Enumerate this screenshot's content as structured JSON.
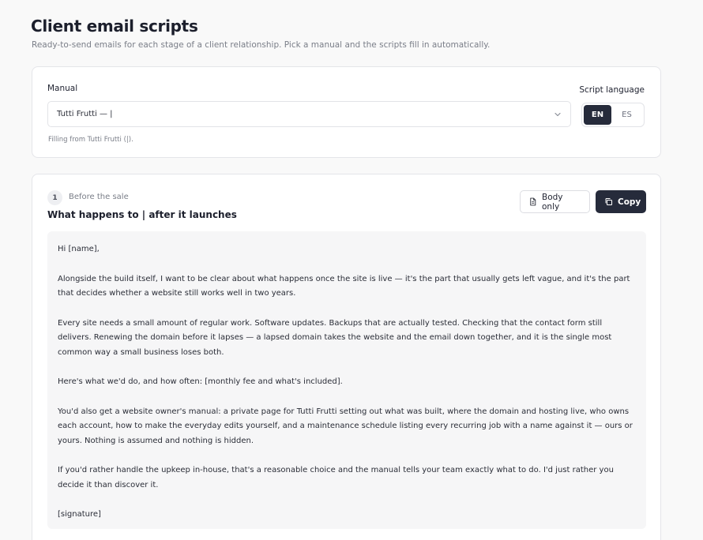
{
  "header": {
    "title": "Client email scripts",
    "subtitle": "Ready-to-send emails for each stage of a client relationship. Pick a manual and the scripts fill in automatically."
  },
  "manual_card": {
    "manual_label": "Manual",
    "selected_manual": "Tutti Frutti — |",
    "filling_hint": "Filling from Tutti Frutti (|).",
    "language_label": "Script language",
    "languages": [
      {
        "code": "EN",
        "active": true
      },
      {
        "code": "ES",
        "active": false
      }
    ]
  },
  "scripts": [
    {
      "step_number": "1",
      "stage": "Before the sale",
      "title": "What happens to | after it launches",
      "body_only_label": "Body only",
      "copy_label": "Copy",
      "paragraphs": [
        "Hi [name],",
        "Alongside the build itself, I want to be clear about what happens once the site is live — it's the part that usually gets left vague, and it's the part that decides whether a website still works well in two years.",
        "Every site needs a small amount of regular work. Software updates. Backups that are actually tested. Checking that the contact form still delivers. Renewing the domain before it lapses — a lapsed domain takes the website and the email down together, and it is the single most common way a small business loses both.",
        "Here's what we'd do, and how often: [monthly fee and what's included].",
        "You'd also get a website owner's manual: a private page for Tutti Frutti setting out what was built, where the domain and hosting live, who owns each account, how to make the everyday edits yourself, and a maintenance schedule listing every recurring job with a name against it — ours or yours. Nothing is assumed and nothing is hidden.",
        "If you'd rather handle the upkeep in-house, that's a reasonable choice and the manual tells your team exactly what to do. I'd just rather you decide it than discover it.",
        "[signature]"
      ]
    }
  ]
}
